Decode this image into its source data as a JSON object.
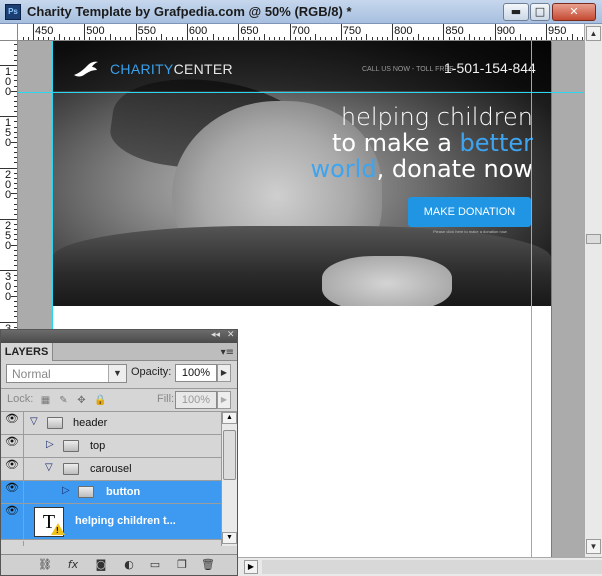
{
  "window": {
    "app_icon": "Ps",
    "title": "Charity Template by Grafpedia.com @ 50% (RGB/8) *",
    "minimize": "▬",
    "maximize": "□",
    "close": "✕"
  },
  "ruler": {
    "top_labels": [
      "450",
      "500",
      "550",
      "600",
      "650",
      "700",
      "750",
      "800",
      "850",
      "900",
      "950"
    ],
    "left_labels": [
      "1 0 0",
      "1 5 0",
      "2 0 0",
      "2 5 0",
      "3 0 0",
      "3"
    ]
  },
  "canvas": {
    "logo_part1": "CHARITY",
    "logo_part2": "CENTER",
    "call_label": "CALL US NOW - TOLL FREE",
    "phone": "1-501-154-844",
    "headline_line1": "helping children",
    "headline_line2_a": "to make a ",
    "headline_line2_b": "better",
    "headline_line3_a": "world",
    "headline_line3_b": ", donate now",
    "donate_button": "MAKE DONATION",
    "donate_note": "Please click here to make a donation now",
    "accent_color": "#3ea4ef",
    "button_color": "#1f95e4",
    "guide_color": "#2ad7f0"
  },
  "layers_panel": {
    "collapse_icon": "◂◂",
    "close_icon": "✕",
    "tab_label": "LAYERS",
    "menu_icon": "▾≡",
    "blend_mode": "Normal",
    "opacity_label": "Opacity:",
    "opacity_value": "100%",
    "lock_label": "Lock:",
    "fill_label": "Fill:",
    "fill_value": "100%",
    "layers": [
      {
        "name": "header",
        "type": "group",
        "expanded": true,
        "visible": true,
        "selected": false
      },
      {
        "name": "top",
        "type": "group",
        "expanded": false,
        "visible": true,
        "selected": false
      },
      {
        "name": "carousel",
        "type": "group",
        "expanded": true,
        "visible": true,
        "selected": false
      },
      {
        "name": "button",
        "type": "group",
        "expanded": false,
        "visible": true,
        "selected": true
      },
      {
        "name": "helping children t...",
        "type": "text",
        "visible": true,
        "selected": true,
        "warning": true
      }
    ],
    "footer_icons": [
      "link-icon",
      "fx-icon",
      "mask-icon",
      "adjustment-icon",
      "new-group-icon",
      "new-layer-icon",
      "trash-icon"
    ],
    "footer_glyphs": [
      "⛓",
      "fx",
      "◙",
      "◐",
      "▭",
      "❐",
      "🗑"
    ]
  }
}
